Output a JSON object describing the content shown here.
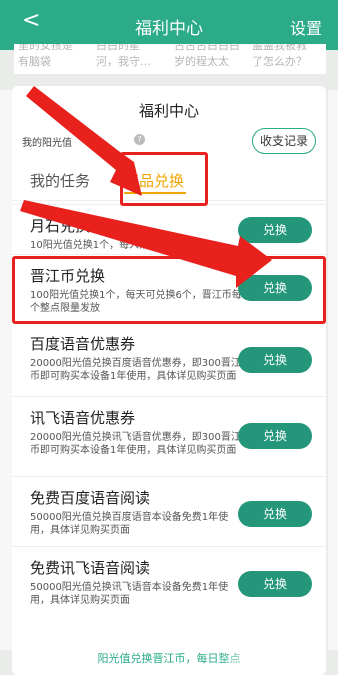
{
  "header": {
    "back_label": "<",
    "title": "福利中心",
    "settings_label": "设置"
  },
  "strip": [
    {
      "line1": "里的女孩是",
      "line2": "有脑袋"
    },
    {
      "line1": "白白的星",
      "line2": "河，我守…"
    },
    {
      "line1": "古古古白白白",
      "line2": "岁的程太太"
    },
    {
      "line1": "盖盖我被救",
      "line2": "了怎么办？"
    }
  ],
  "card": {
    "title": "福利中心",
    "sun_label": "我的阳光值",
    "help_label": "?",
    "records_button": "收支记录",
    "tabs": [
      "我的任务",
      "奖品兑换"
    ],
    "active_tab": "奖品兑换"
  },
  "items": [
    {
      "title": "月石兑换",
      "desc": "10阳光值兑换1个，每人限兑换多个",
      "button": "兑换"
    },
    {
      "title": "晋江币兑换",
      "desc": "100阳光值兑换1个，每天可兑换6个，晋江币每个整点限量发放",
      "button": "兑换"
    },
    {
      "title": "百度语音优惠券",
      "desc": "20000阳光值兑换百度语音优惠券，即300晋江币即可购买本设备1年使用，具体详见购买页面",
      "button": "兑换"
    },
    {
      "title": "讯飞语音优惠券",
      "desc": "20000阳光值兑换讯飞语音优惠券，即300晋江币即可购买本设备1年使用，具体详见购买页面",
      "button": "兑换"
    },
    {
      "title": "免费百度语音阅读",
      "desc": "50000阳光值兑换百度语音本设备免费1年使用，具体详见购买页面",
      "button": "兑换"
    },
    {
      "title": "免费讯飞语音阅读",
      "desc": "50000阳光值兑换讯飞语音本设备免费1年使用，具体详见购买页面",
      "button": "兑换"
    }
  ],
  "footer_note": "阳光值兑换晋江币，每日整点",
  "colors": {
    "header": "#2bab88",
    "button": "#249679",
    "active_tab": "#f0a500",
    "annotation": "#e8211d"
  }
}
